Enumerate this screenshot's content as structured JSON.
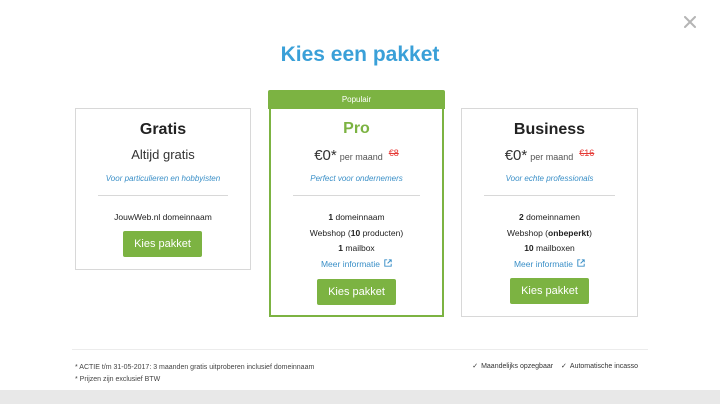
{
  "title": "Kies een pakket",
  "badge": "Populair",
  "plans": {
    "gratis": {
      "name": "Gratis",
      "sub": "Altijd gratis",
      "tagline": "Voor particulieren en hobbyisten",
      "features": [
        "JouwWeb.nl domeinnaam"
      ],
      "cta": "Kies pakket"
    },
    "pro": {
      "name": "Pro",
      "price": "€0*",
      "per": "per maand",
      "old_price": "€8",
      "tagline": "Perfect voor ondernemers",
      "f1_num": "1",
      "f1_text": " domeinnaam",
      "f2_pre": "Webshop (",
      "f2_num": "10",
      "f2_post": " producten)",
      "f3_num": "1",
      "f3_text": " mailbox",
      "more": "Meer informatie",
      "cta": "Kies pakket"
    },
    "business": {
      "name": "Business",
      "price": "€0*",
      "per": "per maand",
      "old_price": "€16",
      "tagline": "Voor echte professionals",
      "f1_num": "2",
      "f1_text": " domeinnamen",
      "f2_pre": "Webshop (",
      "f2_num": "onbeperkt",
      "f2_post": ")",
      "f3_num": "10",
      "f3_text": " mailboxen",
      "more": "Meer informatie",
      "cta": "Kies pakket"
    }
  },
  "notes": [
    "* ACTIE t/m 31-05-2017: 3 maanden gratis uitproberen inclusief domeinnaam",
    "* Prijzen zijn exclusief BTW"
  ],
  "checks": [
    "Maandelijks opzegbaar",
    "Automatische incasso"
  ],
  "icons": {
    "close": "close-icon",
    "external": "external-link-icon",
    "check": "check-icon"
  },
  "colors": {
    "accent_green": "#7cb342",
    "title_blue": "#3aa0d8",
    "link_blue": "#3a8fc7",
    "old_price_red": "#e53935"
  }
}
